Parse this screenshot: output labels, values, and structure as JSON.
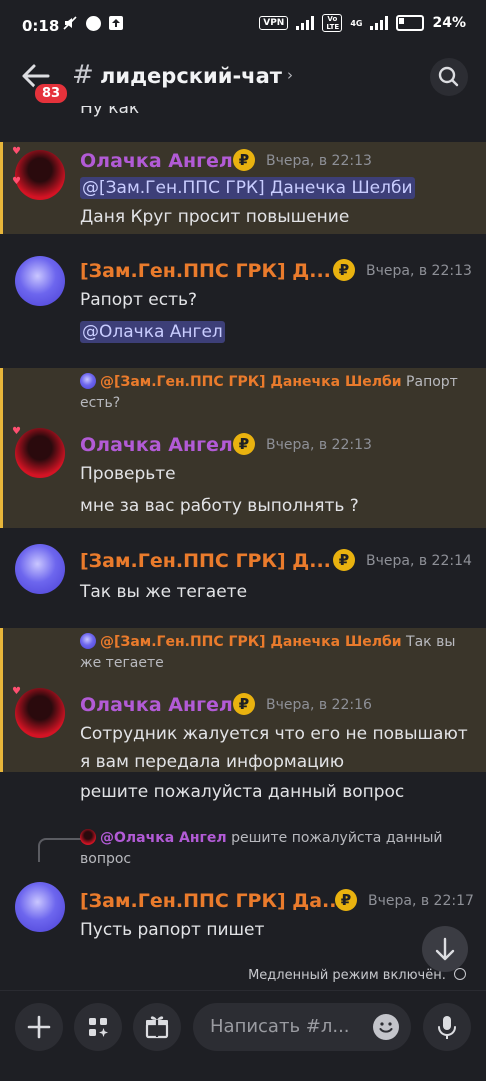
{
  "status_bar": {
    "time": "0:18",
    "battery": "24%",
    "vpn": "VPN",
    "network": "4G",
    "volte": "Vo LTE"
  },
  "header": {
    "unread_badge": "83",
    "channel_name": "лидерский-чат"
  },
  "partial_top_text": "Ну как",
  "messages": [
    {
      "author": "Олачка Ангел",
      "timestamp": "Вчера, в 22:13",
      "highlighted": true,
      "line1_mention": "@[Зам.Ген.ППС ГРК] Данечка Шелби",
      "line2": "Даня Круг просит повышение"
    },
    {
      "author": "[Зам.Ген.ППС ГРК] Д...",
      "timestamp": "Вчера, в 22:13",
      "line1": "Рапорт есть?",
      "line2_mention": "@Олачка Ангел"
    },
    {
      "author": "Олачка Ангел",
      "timestamp": "Вчера, в 22:13",
      "highlighted": true,
      "reply_author": "@[Зам.Ген.ППС ГРК] Данечка Шелби",
      "reply_text": "Рапорт",
      "reply_text_2": "есть?",
      "line1": "Проверьте",
      "line2": "мне за вас работу выполнять ?"
    },
    {
      "author": "[Зам.Ген.ППС ГРК] Д...",
      "timestamp": "Вчера, в 22:14",
      "line1": "Так вы же тегаете"
    },
    {
      "author": "Олачка Ангел",
      "timestamp": "Вчера, в 22:16",
      "highlighted": true,
      "reply_author": "@[Зам.Ген.ППС ГРК] Данечка Шелби",
      "reply_text": "Так вы",
      "reply_text_2": "же тегаете",
      "line1": "Сотрудник жалуется что его не повышают",
      "line2": "я вам передала информацию",
      "line3": "решите пожалуйста  данный вопрос"
    },
    {
      "author": "[Зам.Ген.ППС ГРК] Да...",
      "timestamp": "Вчера, в 22:17",
      "reply_author": "@Олачка Ангел",
      "reply_text": "решите пожалуйста  данный",
      "reply_text_2": "вопрос",
      "line1": "Пусть рапорт пишет"
    }
  ],
  "ruble_symbol": "₽",
  "slowmode_text": "Медленный режим включён.",
  "composer": {
    "placeholder": "Написать #л..."
  },
  "colors": {
    "background": "#1e1f24",
    "highlight_bg": "#3a352a",
    "highlight_bar": "#e8b63a",
    "role_orange": "#ea7b2c",
    "role_purple": "#b25bd6",
    "mention_bg": "#3d3f78",
    "badge_red": "#e5323b"
  }
}
